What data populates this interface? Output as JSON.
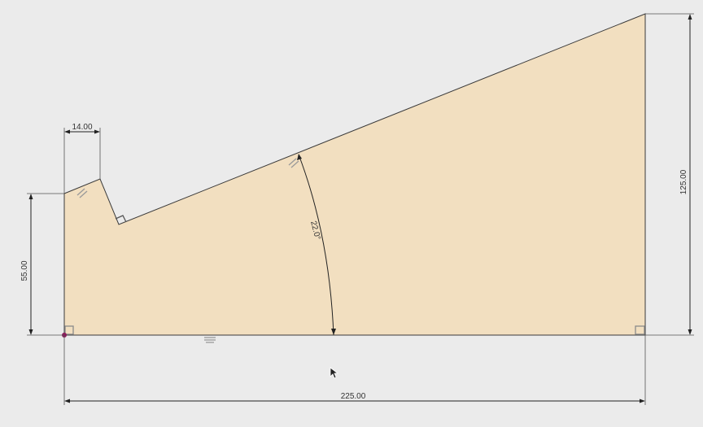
{
  "sketch": {
    "fill_color": "#f2dfc0",
    "outline_color": "#3a3a3a",
    "origin_color": "#8b1a5a"
  },
  "dimensions": {
    "left_height": "55.00",
    "notch_width": "14.00",
    "right_height": "125.00",
    "total_width": "225.00",
    "angle": "22.0°"
  },
  "icons": {
    "cursor": "mouse-pointer-icon",
    "parallel": "parallel-constraint-icon",
    "perpendicular": "perpendicular-constraint-icon",
    "horizontal": "horizontal-constraint-icon",
    "origin": "origin-point-icon"
  }
}
